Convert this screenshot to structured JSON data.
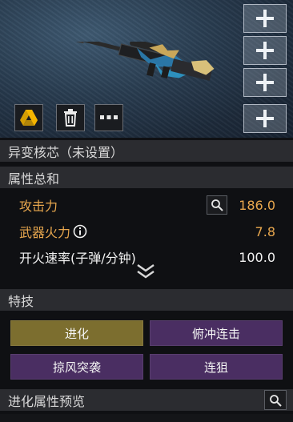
{
  "preview": {
    "tools": [
      {
        "icon": "drive-icon"
      },
      {
        "icon": "trash-icon"
      },
      {
        "icon": "more-icon"
      }
    ]
  },
  "mutation_core": "异变核芯（未设置）",
  "attributes": {
    "title": "属性总和",
    "stats": [
      {
        "label": "攻击力",
        "value": "186.0"
      },
      {
        "label": "武器火力",
        "value": "7.8"
      },
      {
        "label": "开火速率(子弹/分钟)",
        "value": "100.0"
      }
    ]
  },
  "skills": {
    "title": "特技",
    "items": [
      "进化",
      "俯冲连击",
      "掠风突袭",
      "连狙"
    ]
  },
  "evolution_preview": {
    "title": "进化属性预览"
  },
  "colors": {
    "gold": "#e8a74e",
    "selected_skill": "#7c6e2f",
    "skill": "#4a2e62"
  }
}
